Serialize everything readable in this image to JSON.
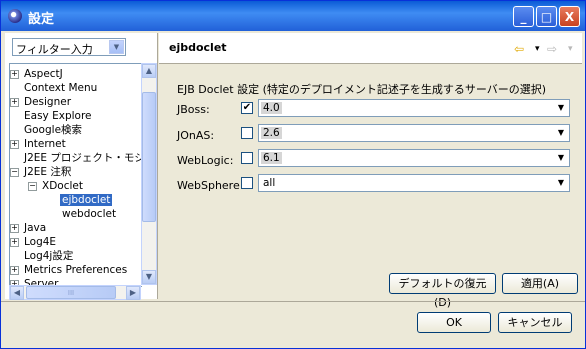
{
  "window": {
    "title": "設定",
    "min": "_",
    "max": "□",
    "close": "X"
  },
  "filter": {
    "value": "フィルター入力"
  },
  "tree": {
    "items": [
      {
        "label": "AspectJ",
        "expander": "+"
      },
      {
        "label": "Context Menu"
      },
      {
        "label": "Designer",
        "expander": "+"
      },
      {
        "label": "Easy Explore"
      },
      {
        "label": "Google検索"
      },
      {
        "label": "Internet",
        "expander": "+"
      },
      {
        "label": "J2EE プロジェクト・モジ"
      },
      {
        "label": "J2EE 注釈",
        "expander": "−"
      },
      {
        "label": "XDoclet",
        "expander": "−"
      },
      {
        "label": "ejbdoclet",
        "selected": true
      },
      {
        "label": "webdoclet"
      },
      {
        "label": "Java",
        "expander": "+"
      },
      {
        "label": "Log4E",
        "expander": "+"
      },
      {
        "label": "Log4j設定"
      },
      {
        "label": "Metrics Preferences",
        "expander": "+"
      },
      {
        "label": "Server",
        "expander": "+"
      }
    ],
    "hscroll_thumb": "III"
  },
  "page": {
    "title": "ejbdoclet",
    "nav": {
      "back": "⇦",
      "drop": "▾",
      "forward": "⇨",
      "drop2": "▾"
    },
    "group": "EJB Doclet 設定 (特定のデプロイメント記述子を生成するサーバーの選択)",
    "rows": [
      {
        "label": "JBoss:",
        "checked": "✔",
        "value": "4.0"
      },
      {
        "label": "JOnAS:",
        "checked": "",
        "value": "2.6"
      },
      {
        "label": "WebLogic:",
        "checked": "",
        "value": "6.1"
      },
      {
        "label": "WebSphere:",
        "checked": "",
        "value": "all"
      }
    ],
    "restore_label": "デフォルトの復元(D)",
    "apply_label": "適用(A)"
  },
  "footer": {
    "ok_label": "OK",
    "cancel_label": "キャンセル"
  },
  "glyphs": {
    "down": "▼",
    "up": "▲",
    "left": "◀",
    "right": "▶"
  }
}
